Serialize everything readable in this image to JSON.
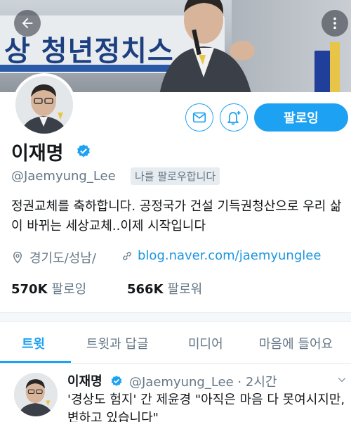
{
  "header": {
    "banner_text": "상 청년정치스",
    "back_icon": "arrow-left-icon",
    "more_icon": "more-vertical-icon"
  },
  "profile": {
    "name": "이재명",
    "handle": "@Jaemyung_Lee",
    "follows_you": "나를 팔로우합니다",
    "bio": "정권교체를 축하합니다. 공정국가 건설 기득권청산으로 우리 삶이 바뀌는 세상교체..이제 시작입니다",
    "location": "경기도/성남/",
    "website": "blog.naver.com/jaemyunglee",
    "following_count": "570K",
    "following_label": "팔로잉",
    "followers_count": "566K",
    "followers_label": "팔로워"
  },
  "actions": {
    "follow_label": "팔로잉",
    "mail_icon": "envelope-icon",
    "notify_icon": "bell-plus-icon"
  },
  "tabs": [
    {
      "label": "트윗",
      "active": true
    },
    {
      "label": "트윗과 답글",
      "active": false
    },
    {
      "label": "미디어",
      "active": false
    },
    {
      "label": "마음에 들어요",
      "active": false
    }
  ],
  "tweet": {
    "name": "이재명",
    "handle_time": "@Jaemyung_Lee · 2시간",
    "text": "'경상도 험지' 간 제윤경 \"아직은 마음 다 못여시지만, 변하고 있습니다\""
  },
  "colors": {
    "accent": "#1da1f2",
    "link": "#1b95e0",
    "muted": "#657786"
  }
}
